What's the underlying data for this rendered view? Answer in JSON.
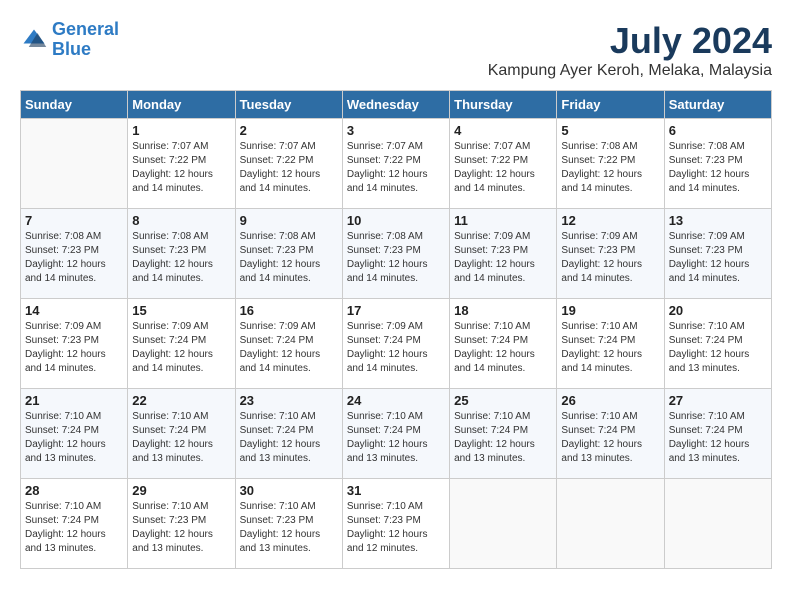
{
  "logo": {
    "line1": "General",
    "line2": "Blue"
  },
  "title": "July 2024",
  "location": "Kampung Ayer Keroh, Melaka, Malaysia",
  "days_header": [
    "Sunday",
    "Monday",
    "Tuesday",
    "Wednesday",
    "Thursday",
    "Friday",
    "Saturday"
  ],
  "weeks": [
    [
      {
        "day": "",
        "sunrise": "",
        "sunset": "",
        "daylight": ""
      },
      {
        "day": "1",
        "sunrise": "Sunrise: 7:07 AM",
        "sunset": "Sunset: 7:22 PM",
        "daylight": "Daylight: 12 hours and 14 minutes."
      },
      {
        "day": "2",
        "sunrise": "Sunrise: 7:07 AM",
        "sunset": "Sunset: 7:22 PM",
        "daylight": "Daylight: 12 hours and 14 minutes."
      },
      {
        "day": "3",
        "sunrise": "Sunrise: 7:07 AM",
        "sunset": "Sunset: 7:22 PM",
        "daylight": "Daylight: 12 hours and 14 minutes."
      },
      {
        "day": "4",
        "sunrise": "Sunrise: 7:07 AM",
        "sunset": "Sunset: 7:22 PM",
        "daylight": "Daylight: 12 hours and 14 minutes."
      },
      {
        "day": "5",
        "sunrise": "Sunrise: 7:08 AM",
        "sunset": "Sunset: 7:22 PM",
        "daylight": "Daylight: 12 hours and 14 minutes."
      },
      {
        "day": "6",
        "sunrise": "Sunrise: 7:08 AM",
        "sunset": "Sunset: 7:23 PM",
        "daylight": "Daylight: 12 hours and 14 minutes."
      }
    ],
    [
      {
        "day": "7",
        "sunrise": "Sunrise: 7:08 AM",
        "sunset": "Sunset: 7:23 PM",
        "daylight": "Daylight: 12 hours and 14 minutes."
      },
      {
        "day": "8",
        "sunrise": "Sunrise: 7:08 AM",
        "sunset": "Sunset: 7:23 PM",
        "daylight": "Daylight: 12 hours and 14 minutes."
      },
      {
        "day": "9",
        "sunrise": "Sunrise: 7:08 AM",
        "sunset": "Sunset: 7:23 PM",
        "daylight": "Daylight: 12 hours and 14 minutes."
      },
      {
        "day": "10",
        "sunrise": "Sunrise: 7:08 AM",
        "sunset": "Sunset: 7:23 PM",
        "daylight": "Daylight: 12 hours and 14 minutes."
      },
      {
        "day": "11",
        "sunrise": "Sunrise: 7:09 AM",
        "sunset": "Sunset: 7:23 PM",
        "daylight": "Daylight: 12 hours and 14 minutes."
      },
      {
        "day": "12",
        "sunrise": "Sunrise: 7:09 AM",
        "sunset": "Sunset: 7:23 PM",
        "daylight": "Daylight: 12 hours and 14 minutes."
      },
      {
        "day": "13",
        "sunrise": "Sunrise: 7:09 AM",
        "sunset": "Sunset: 7:23 PM",
        "daylight": "Daylight: 12 hours and 14 minutes."
      }
    ],
    [
      {
        "day": "14",
        "sunrise": "Sunrise: 7:09 AM",
        "sunset": "Sunset: 7:23 PM",
        "daylight": "Daylight: 12 hours and 14 minutes."
      },
      {
        "day": "15",
        "sunrise": "Sunrise: 7:09 AM",
        "sunset": "Sunset: 7:24 PM",
        "daylight": "Daylight: 12 hours and 14 minutes."
      },
      {
        "day": "16",
        "sunrise": "Sunrise: 7:09 AM",
        "sunset": "Sunset: 7:24 PM",
        "daylight": "Daylight: 12 hours and 14 minutes."
      },
      {
        "day": "17",
        "sunrise": "Sunrise: 7:09 AM",
        "sunset": "Sunset: 7:24 PM",
        "daylight": "Daylight: 12 hours and 14 minutes."
      },
      {
        "day": "18",
        "sunrise": "Sunrise: 7:10 AM",
        "sunset": "Sunset: 7:24 PM",
        "daylight": "Daylight: 12 hours and 14 minutes."
      },
      {
        "day": "19",
        "sunrise": "Sunrise: 7:10 AM",
        "sunset": "Sunset: 7:24 PM",
        "daylight": "Daylight: 12 hours and 14 minutes."
      },
      {
        "day": "20",
        "sunrise": "Sunrise: 7:10 AM",
        "sunset": "Sunset: 7:24 PM",
        "daylight": "Daylight: 12 hours and 13 minutes."
      }
    ],
    [
      {
        "day": "21",
        "sunrise": "Sunrise: 7:10 AM",
        "sunset": "Sunset: 7:24 PM",
        "daylight": "Daylight: 12 hours and 13 minutes."
      },
      {
        "day": "22",
        "sunrise": "Sunrise: 7:10 AM",
        "sunset": "Sunset: 7:24 PM",
        "daylight": "Daylight: 12 hours and 13 minutes."
      },
      {
        "day": "23",
        "sunrise": "Sunrise: 7:10 AM",
        "sunset": "Sunset: 7:24 PM",
        "daylight": "Daylight: 12 hours and 13 minutes."
      },
      {
        "day": "24",
        "sunrise": "Sunrise: 7:10 AM",
        "sunset": "Sunset: 7:24 PM",
        "daylight": "Daylight: 12 hours and 13 minutes."
      },
      {
        "day": "25",
        "sunrise": "Sunrise: 7:10 AM",
        "sunset": "Sunset: 7:24 PM",
        "daylight": "Daylight: 12 hours and 13 minutes."
      },
      {
        "day": "26",
        "sunrise": "Sunrise: 7:10 AM",
        "sunset": "Sunset: 7:24 PM",
        "daylight": "Daylight: 12 hours and 13 minutes."
      },
      {
        "day": "27",
        "sunrise": "Sunrise: 7:10 AM",
        "sunset": "Sunset: 7:24 PM",
        "daylight": "Daylight: 12 hours and 13 minutes."
      }
    ],
    [
      {
        "day": "28",
        "sunrise": "Sunrise: 7:10 AM",
        "sunset": "Sunset: 7:24 PM",
        "daylight": "Daylight: 12 hours and 13 minutes."
      },
      {
        "day": "29",
        "sunrise": "Sunrise: 7:10 AM",
        "sunset": "Sunset: 7:23 PM",
        "daylight": "Daylight: 12 hours and 13 minutes."
      },
      {
        "day": "30",
        "sunrise": "Sunrise: 7:10 AM",
        "sunset": "Sunset: 7:23 PM",
        "daylight": "Daylight: 12 hours and 13 minutes."
      },
      {
        "day": "31",
        "sunrise": "Sunrise: 7:10 AM",
        "sunset": "Sunset: 7:23 PM",
        "daylight": "Daylight: 12 hours and 12 minutes."
      },
      {
        "day": "",
        "sunrise": "",
        "sunset": "",
        "daylight": ""
      },
      {
        "day": "",
        "sunrise": "",
        "sunset": "",
        "daylight": ""
      },
      {
        "day": "",
        "sunrise": "",
        "sunset": "",
        "daylight": ""
      }
    ]
  ]
}
